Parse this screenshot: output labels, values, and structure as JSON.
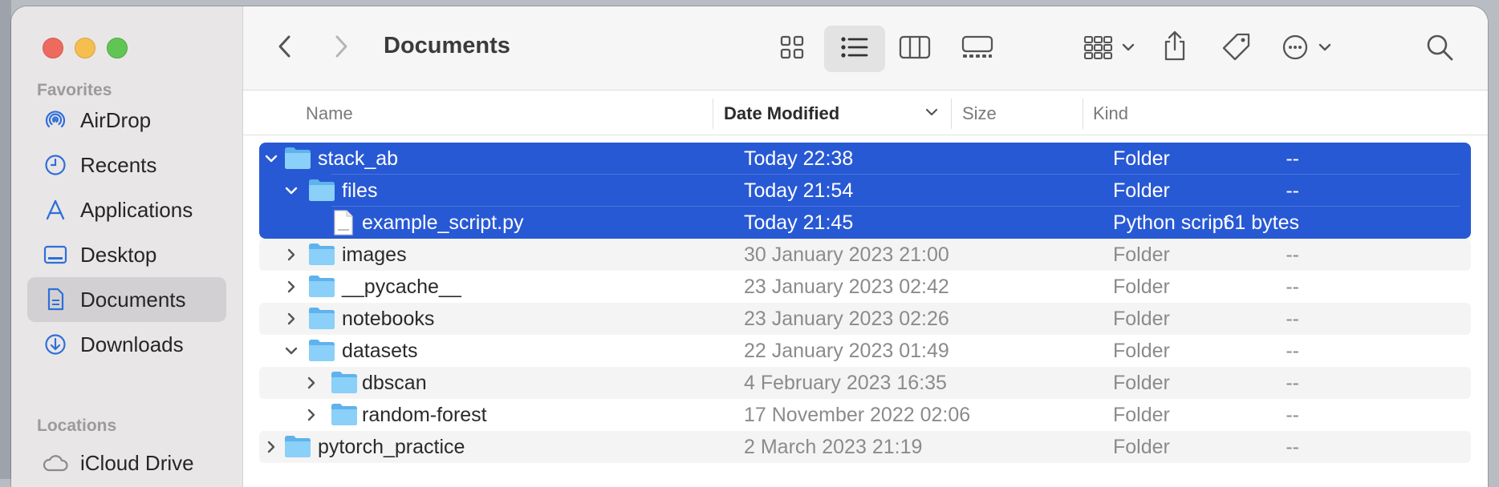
{
  "window": {
    "title": "Documents"
  },
  "sidebar": {
    "favorites_heading": "Favorites",
    "locations_heading": "Locations",
    "items": [
      {
        "label": "AirDrop",
        "icon": "airdrop-icon"
      },
      {
        "label": "Recents",
        "icon": "clock-icon"
      },
      {
        "label": "Applications",
        "icon": "applications-icon"
      },
      {
        "label": "Desktop",
        "icon": "desktop-icon"
      },
      {
        "label": "Documents",
        "icon": "document-icon",
        "active": true
      },
      {
        "label": "Downloads",
        "icon": "download-icon"
      }
    ],
    "locations": [
      {
        "label": "iCloud Drive",
        "icon": "cloud-icon"
      }
    ]
  },
  "toolbar": {
    "view_mode": "list",
    "icons": [
      "back-icon",
      "forward-icon",
      "grid-view-icon",
      "list-view-icon",
      "column-view-icon",
      "gallery-view-icon",
      "group-icon",
      "share-icon",
      "tag-icon",
      "more-actions-icon",
      "search-icon"
    ]
  },
  "columns": {
    "name": "Name",
    "date": "Date Modified",
    "size": "Size",
    "kind": "Kind",
    "sorted_by": "date"
  },
  "rows": [
    {
      "name": "stack_ab",
      "date": "Today 22:38",
      "size": "--",
      "kind": "Folder",
      "level": 0,
      "type": "folder",
      "expanded": true,
      "selected": true
    },
    {
      "name": "files",
      "date": "Today 21:54",
      "size": "--",
      "kind": "Folder",
      "level": 1,
      "type": "folder",
      "expanded": true,
      "selected": true
    },
    {
      "name": "example_script.py",
      "date": "Today 21:45",
      "size": "61 bytes",
      "kind": "Python script",
      "level": 2,
      "type": "file",
      "selected": true
    },
    {
      "name": "images",
      "date": "30 January 2023 21:00",
      "size": "--",
      "kind": "Folder",
      "level": 1,
      "type": "folder",
      "expanded": false
    },
    {
      "name": "__pycache__",
      "date": "23 January 2023 02:42",
      "size": "--",
      "kind": "Folder",
      "level": 1,
      "type": "folder",
      "expanded": false
    },
    {
      "name": "notebooks",
      "date": "23 January 2023 02:26",
      "size": "--",
      "kind": "Folder",
      "level": 1,
      "type": "folder",
      "expanded": false
    },
    {
      "name": "datasets",
      "date": "22 January 2023 01:49",
      "size": "--",
      "kind": "Folder",
      "level": 1,
      "type": "folder",
      "expanded": true
    },
    {
      "name": "dbscan",
      "date": "4 February 2023 16:35",
      "size": "--",
      "kind": "Folder",
      "level": 2,
      "type": "folder",
      "expanded": false
    },
    {
      "name": "random-forest",
      "date": "17 November 2022 02:06",
      "size": "--",
      "kind": "Folder",
      "level": 2,
      "type": "folder",
      "expanded": false
    },
    {
      "name": "pytorch_practice",
      "date": "2 March 2023 21:19",
      "size": "--",
      "kind": "Folder",
      "level": 0,
      "type": "folder",
      "expanded": false
    }
  ],
  "colors": {
    "selection": "#2859d4",
    "accent": "#2f6fd8",
    "folder": "#7cc4f4"
  }
}
